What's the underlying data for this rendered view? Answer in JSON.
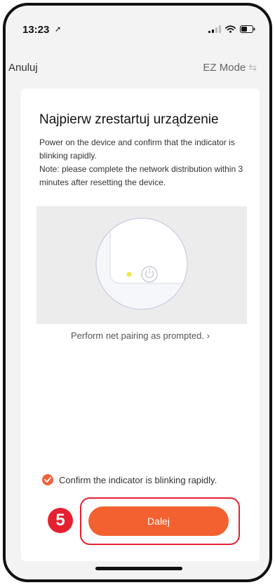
{
  "status_bar": {
    "time": "13:23",
    "location_icon": "location-arrow-icon"
  },
  "nav": {
    "cancel_label": "Anuluj",
    "mode_label": "EZ Mode",
    "mode_icon": "swap-icon"
  },
  "content": {
    "title": "Najpierw zrestartuj urządzenie",
    "description_line1": "Power on the device and confirm that the indicator is blinking rapidly.",
    "description_line2": "Note: please complete the network distribution within 3 minutes after resetting the device.",
    "prompt_link": "Perform net pairing as prompted.",
    "prompt_chevron": "›",
    "confirm_label": "Confirm the indicator is blinking rapidly.",
    "next_label": "Dalej"
  },
  "annotation": {
    "step_number": "5"
  },
  "colors": {
    "accent": "#f2612f",
    "annotation": "#e6212f",
    "indicator_led": "#f5e64a"
  }
}
